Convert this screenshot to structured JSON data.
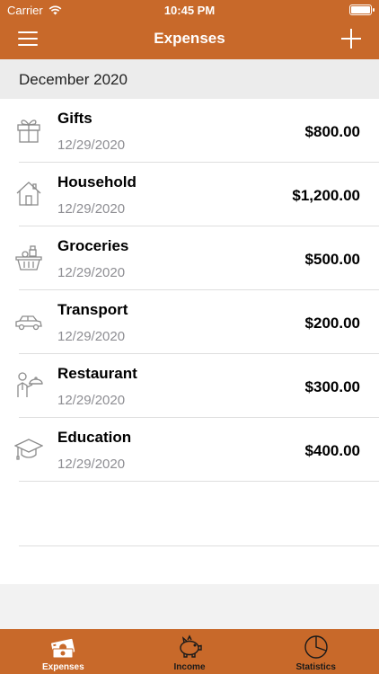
{
  "status_bar": {
    "carrier": "Carrier",
    "time": "10:45 PM"
  },
  "nav": {
    "title": "Expenses",
    "menu_icon": "hamburger-menu-icon",
    "add_icon": "plus-icon"
  },
  "section": {
    "title": "December 2020"
  },
  "expenses": [
    {
      "name": "Gifts",
      "date": "12/29/2020",
      "amount": "$800.00",
      "icon": "gift-icon"
    },
    {
      "name": "Household",
      "date": "12/29/2020",
      "amount": "$1,200.00",
      "icon": "house-icon"
    },
    {
      "name": "Groceries",
      "date": "12/29/2020",
      "amount": "$500.00",
      "icon": "grocery-basket-icon"
    },
    {
      "name": "Transport",
      "date": "12/29/2020",
      "amount": "$200.00",
      "icon": "car-icon"
    },
    {
      "name": "Restaurant",
      "date": "12/29/2020",
      "amount": "$300.00",
      "icon": "waiter-icon"
    },
    {
      "name": "Education",
      "date": "12/29/2020",
      "amount": "$400.00",
      "icon": "graduation-cap-icon"
    }
  ],
  "tabs": [
    {
      "label": "Expenses",
      "icon": "money-icon",
      "active": true
    },
    {
      "label": "Income",
      "icon": "piggy-bank-icon",
      "active": false
    },
    {
      "label": "Statistics",
      "icon": "pie-chart-icon",
      "active": false
    }
  ],
  "colors": {
    "accent": "#c8692a",
    "active_tab_label": "#ffffff",
    "inactive_tab_label": "#1a1a1a",
    "date_text": "#8e8e93"
  }
}
